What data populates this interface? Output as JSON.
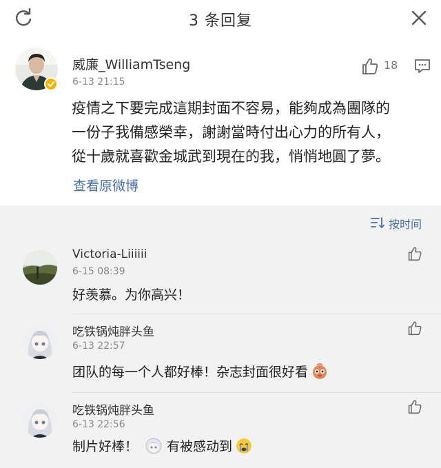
{
  "header": {
    "title": "3 条回复",
    "refresh_icon": "refresh-icon",
    "close_icon": "close-icon"
  },
  "original_post": {
    "author": "威廉_WilliamTseng",
    "time": "6-13 21:15",
    "like_count": "18",
    "verified": true,
    "content_lines": [
      "疫情之下要完成這期封面不容易，能夠成為團隊的",
      "一份子我備感榮幸，謝謝當時付出心力的所有人，",
      "從十歲就喜歡金城武到現在的我，悄悄地圓了夢。"
    ],
    "view_link": "查看原微博"
  },
  "sort": {
    "label": "按时间"
  },
  "replies": [
    {
      "author": "Victoria-Liiiiii",
      "time": "6-15 08:39",
      "text": "好羡慕。为你高兴！"
    },
    {
      "author": "吃铁锅炖胖头鱼",
      "time": "6-13 22:57",
      "text": "团队的每一个人都好棒！杂志封面很好看",
      "emoji_after": "cute-creature-emoji"
    },
    {
      "author": "吃铁锅炖胖头鱼",
      "time": "6-13 22:56",
      "text_before": "制片好棒！",
      "emoji_middle": "anime-girl-sticker",
      "text_after": "有被感动到",
      "emoji_after": "crying-face-emoji"
    }
  ],
  "colors": {
    "link": "#4b6ea3",
    "background": "#f2f2f2",
    "verified_badge": "#f7b500"
  }
}
